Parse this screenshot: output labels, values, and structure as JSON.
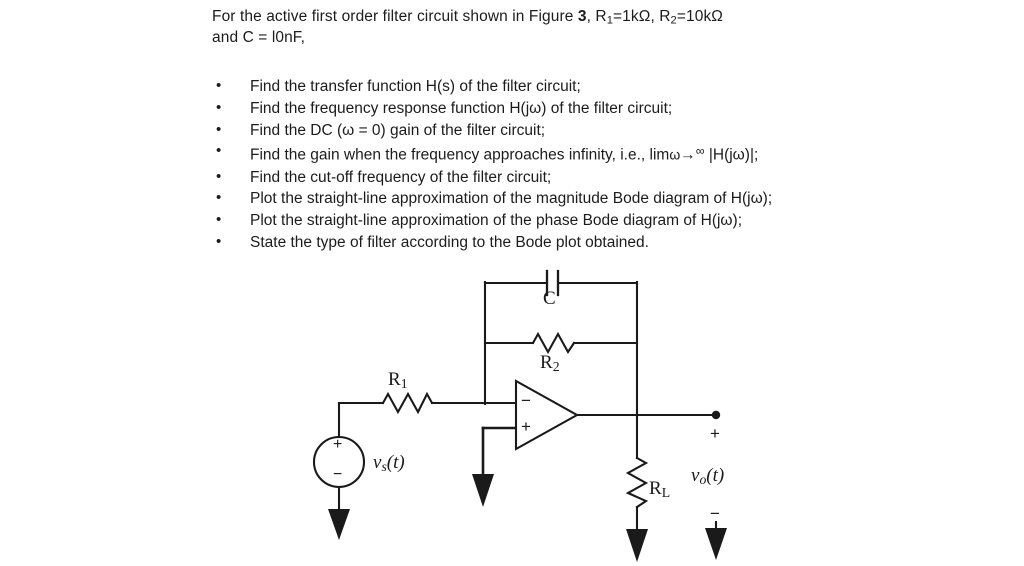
{
  "prompt": {
    "line1_a": "For the active first order filter circuit shown in Figure ",
    "figure_number": "3",
    "line1_b": ", R",
    "r1_sub": "1",
    "r1_val": "=1kΩ, R",
    "r2_sub": "2",
    "r2_val": "=10kΩ",
    "line2": "and C = l0nF,"
  },
  "tasks": [
    "Find the transfer function H(s) of the filter circuit;",
    "Find the frequency response function H(jω) of the filter circuit;",
    "Find the DC (ω = 0) gain of the filter circuit;",
    "Find the cut-off frequency of the filter circuit;",
    "Plot the straight-line approximation of the magnitude Bode diagram of H(jω);",
    "Plot the straight-line approximation of the phase Bode diagram of H(jω);",
    "State the type of filter according to the Bode plot obtained."
  ],
  "task_infinity": {
    "prefix": "Find the gain when the frequency approaches infinity, i.e.,  lim",
    "omega": "ω",
    "arrow": "→",
    "infinity": "∞",
    "suffix": " |H(jω)|;"
  },
  "circuit": {
    "labels": {
      "r1": "R",
      "r1_sub": "1",
      "r2": "R",
      "r2_sub": "2",
      "c": "C",
      "rl": "R",
      "rl_sub": "L",
      "vs": "v",
      "vs_sub": "s",
      "vs_arg": "(t)",
      "vo": "v",
      "vo_sub": "o",
      "vo_arg": "(t)",
      "source_plus": "+",
      "source_minus": "−",
      "output_plus": "+",
      "output_minus": "−",
      "opamp_inverting": "−",
      "opamp_noninverting": "+"
    },
    "colors": {
      "wire": "#1a1a1a",
      "background": "#ffffff"
    }
  }
}
